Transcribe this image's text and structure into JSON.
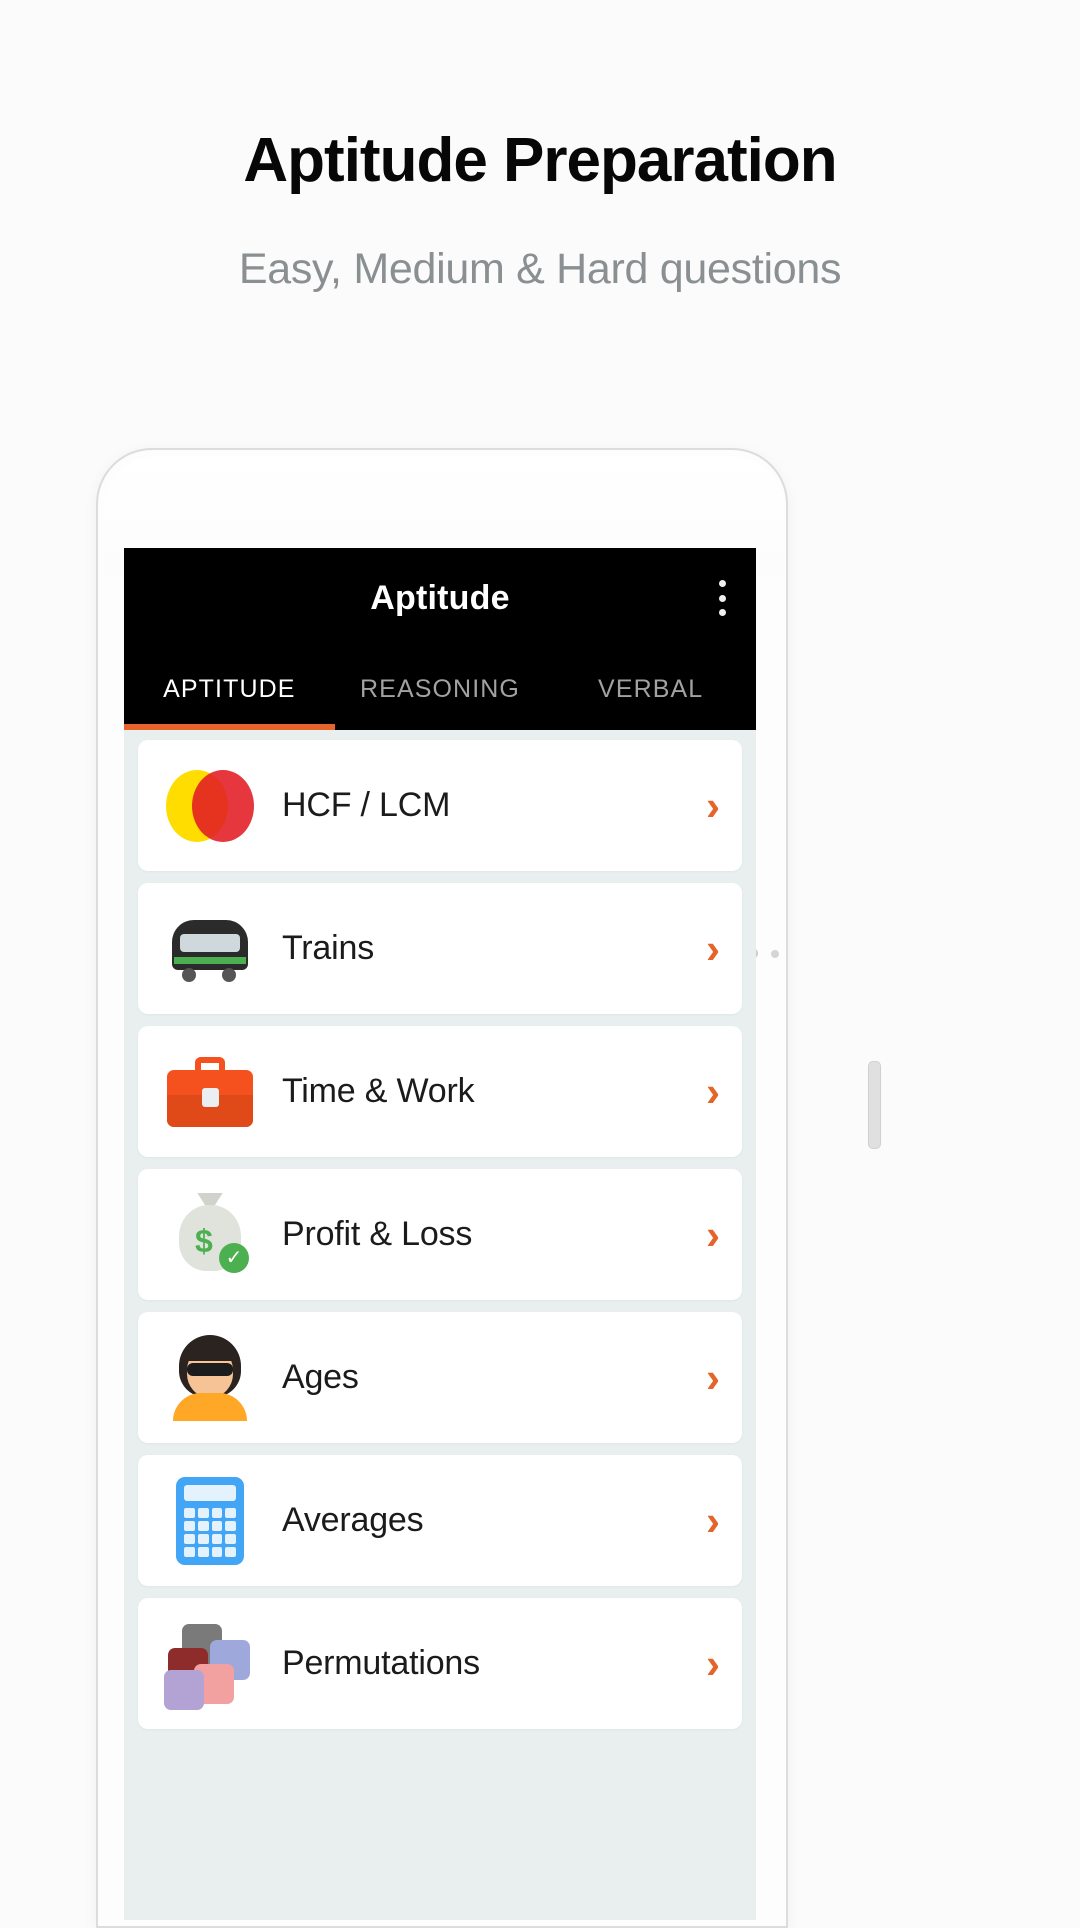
{
  "header": {
    "title": "Aptitude Preparation",
    "subtitle": "Easy, Medium & Hard questions"
  },
  "colors": {
    "accent_orange": "#e4642a",
    "app_bar_black": "#000000",
    "list_background": "#e8efee",
    "card_white": "#ffffff",
    "title_black": "#070707",
    "subtitle_gray": "#8a8f92",
    "tab_inactive_gray": "#a2a2a2"
  },
  "app": {
    "app_bar": {
      "title": "Aptitude",
      "overflow_icon": "more-vertical-icon"
    },
    "tabs": [
      {
        "label": "APTITUDE",
        "active": true
      },
      {
        "label": "REASONING",
        "active": false
      },
      {
        "label": "VERBAL",
        "active": false
      }
    ],
    "topics": [
      {
        "label": "HCF / LCM",
        "icon": "venn-circles-icon",
        "chevron": "›"
      },
      {
        "label": "Trains",
        "icon": "tram-icon",
        "chevron": "›"
      },
      {
        "label": "Time & Work",
        "icon": "briefcase-icon",
        "chevron": "›"
      },
      {
        "label": "Profit & Loss",
        "icon": "money-bag-icon",
        "chevron": "›"
      },
      {
        "label": "Ages",
        "icon": "woman-icon",
        "chevron": "›"
      },
      {
        "label": "Averages",
        "icon": "calculator-icon",
        "chevron": "›"
      },
      {
        "label": "Permutations",
        "icon": "puzzle-pieces-icon",
        "chevron": "›"
      }
    ]
  }
}
